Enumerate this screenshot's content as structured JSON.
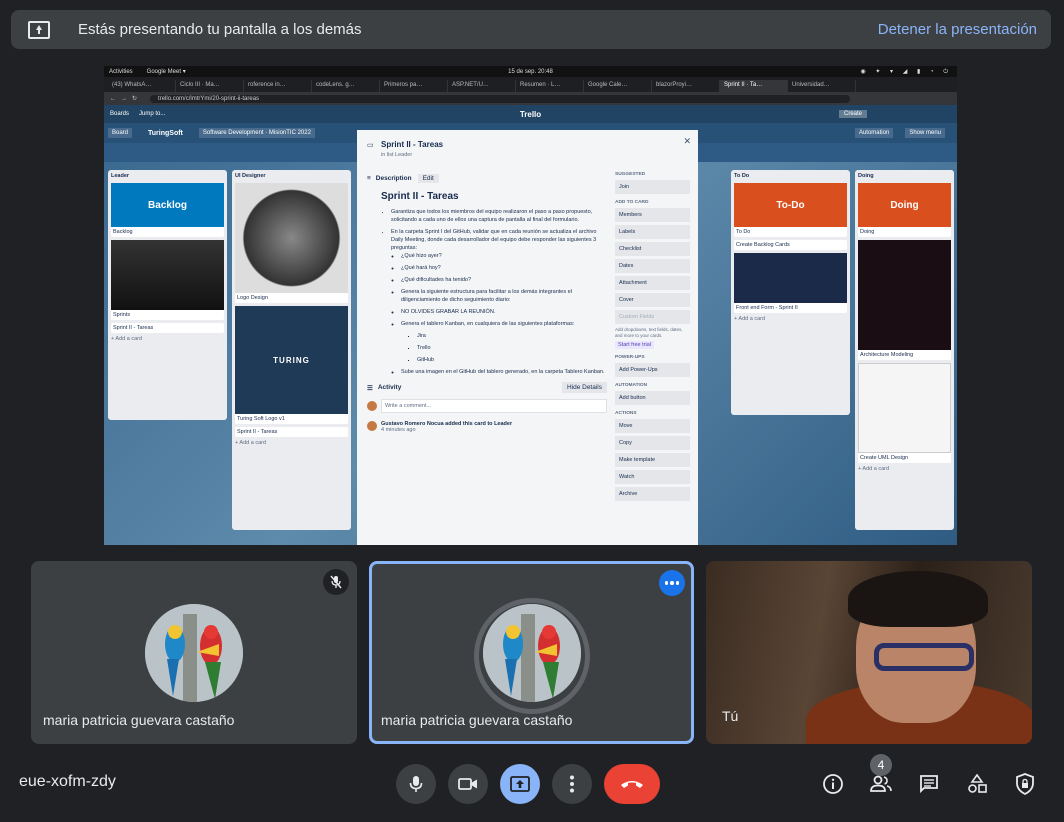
{
  "banner": {
    "message": "Estás presentando tu pantalla a los demás",
    "stop_label": "Detener la presentación"
  },
  "shared_screen": {
    "os_bar": {
      "activities": "Activities",
      "app": "Google Meet ▾",
      "clock": "15 de sep. 20:48"
    },
    "tabs": [
      "(43) WhatsA…",
      "Ciclo III · Ma…",
      "roference in…",
      "codeLens. g…",
      "Primeros pa…",
      "ASP.NET/U…",
      "Resumen · L…",
      "Google Cale…",
      "blazorProyi…",
      "Sprint II · Ta…",
      "Universidad…"
    ],
    "active_tab_index": 9,
    "url": "trello.com/c/lmtrYmi/20-sprint-ii-tareas",
    "trello": {
      "boards_label": "Boards",
      "jump_label": "Jump to...",
      "logo": "Trello",
      "create": "Create",
      "board_name": "TuringSoft",
      "board_menu": "Board",
      "workspace": "Software Development · MisionTIC 2022",
      "automation": "Automation",
      "show_menu": "Show menu",
      "lists": [
        {
          "title": "Leader",
          "cards": [
            "Backlog",
            "Sprints",
            "Sprint II - Tareas"
          ],
          "cover": "Backlog",
          "add": "+ Add a card"
        },
        {
          "title": "UI Designer",
          "cards": [
            "Logo Design",
            "Turing Soft Logo v1",
            "Sprint II - Tareas"
          ],
          "cover_text": "TURING",
          "add": "+ Add a card"
        },
        {
          "title": "To Do",
          "cards": [
            "To Do",
            "Create Backlog Cards",
            "Front end Form - Sprint II"
          ],
          "cover": "To-Do",
          "add": "+ Add a card"
        },
        {
          "title": "Doing",
          "cards": [
            "Doing",
            "Architecture Modeling",
            "Create UML Design"
          ],
          "cover": "Doing",
          "add": "+ Add a card"
        }
      ],
      "modal": {
        "title": "Sprint II - Tareas",
        "in_list": "in list Leader",
        "description_label": "Description",
        "edit": "Edit",
        "heading": "Sprint II - Tareas",
        "bullets": [
          "Garantiza que todos los miembros del equipo realizaron el paso a paso propuesto, solicitando a cada uno de ellos una captura de pantalla al final del formulario.",
          "En la carpeta Sprint I del GitHub, validar que en cada reunión se actualiza el archivo Daily Meeting, donde cada desarrollador del equipo debe responder las siguientes 3 preguntas:"
        ],
        "questions": [
          "¿Qué hizo ayer?",
          "¿Qué hará hoy?",
          "¿Qué dificultades ha tenido?"
        ],
        "more_bullets": [
          "Genera la siguiente estructura para facilitar a los demás integrantes el diligenciamiento de dicho seguimiento diario:",
          "NO OLVIDES GRABAR LA REUNIÓN.",
          "Genera el tablero Kanban, en cualquiera de las siguientes plataformas:"
        ],
        "platforms": [
          "Jira",
          "Trello",
          "GitHub"
        ],
        "last_bullet": "Sube una imagen en el GitHub del tablero generado, en la carpeta Tablero Kanban.",
        "activity_label": "Activity",
        "hide_details": "Hide Details",
        "comment_placeholder": "Write a comment...",
        "log_text": "Gustavo Romero Nocua added this card to Leader",
        "log_time": "4 minutes ago",
        "sidebar": {
          "suggested": "SUGGESTED",
          "join": "Join",
          "add_to_card": "ADD TO CARD",
          "buttons": [
            "Members",
            "Labels",
            "Checklist",
            "Dates",
            "Attachment",
            "Cover"
          ],
          "custom_fields": "Custom Fields",
          "note": "Add dropdowns, text fields, dates, and more to your cards.",
          "trial": "Start free trial",
          "power_ups": "POWER-UPS",
          "add_power_ups": "Add Power-Ups",
          "automation": "AUTOMATION",
          "add_button": "Add button",
          "actions": "ACTIONS",
          "action_buttons": [
            "Move",
            "Copy",
            "Make template",
            "Watch",
            "Archive"
          ]
        }
      }
    }
  },
  "participants": [
    {
      "name": "maria patricia guevara castaño",
      "muted": true
    },
    {
      "name": "maria patricia guevara castaño",
      "pinned": true
    },
    {
      "name": "Tú"
    }
  ],
  "controls": {
    "meeting_code": "eue-xofm-zdy",
    "people_count": "4"
  },
  "colors": {
    "background": "#202124",
    "accent": "#8ab4f8",
    "hangup": "#ea4335",
    "more_button": "#1a73e8"
  }
}
